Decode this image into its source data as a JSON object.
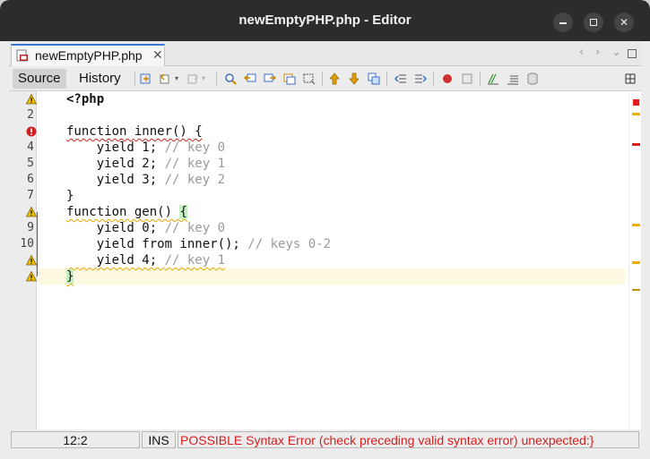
{
  "window": {
    "title": "newEmptyPHP.php - Editor",
    "controls": [
      "minimize",
      "maximize",
      "close"
    ]
  },
  "tabs": [
    {
      "label": "newEmptyPHP.php",
      "icon": "php-file-icon",
      "close": "✕"
    }
  ],
  "toolbar": {
    "source_label": "Source",
    "history_label": "History"
  },
  "editor": {
    "line_numbers": [
      "",
      "2",
      "",
      "4",
      "5",
      "6",
      "7",
      "",
      "9",
      "10",
      "",
      ""
    ],
    "gutter_icons": [
      {
        "line": 1,
        "icon": "warning-bulb-icon"
      },
      {
        "line": 3,
        "icon": "error-icon"
      },
      {
        "line": 8,
        "icon": "warning-icon"
      },
      {
        "line": 11,
        "icon": "warning-icon"
      },
      {
        "line": 12,
        "icon": "warning-icon"
      }
    ],
    "lines": [
      "<?php",
      "",
      "function inner() {",
      "    yield 1; // key 0",
      "    yield 2; // key 1",
      "    yield 3; // key 2",
      "}",
      "function gen() {",
      "    yield 0; // key 0",
      "    yield from inner(); // keys 0-2",
      "    yield 4; // key 1",
      "}"
    ],
    "code_parts": {
      "l3_kw": "function ",
      "l3_name": "inner() {",
      "l4_code": "    yield 1; ",
      "l4_cmt": "// key 0",
      "l5_code": "    yield 2; ",
      "l5_cmt": "// key 1",
      "l6_code": "    yield 3; ",
      "l6_cmt": "// key 2",
      "l7": "}",
      "l8_pre": "function gen() ",
      "l8_brace": "{",
      "l9_code": "    yield 0; ",
      "l9_cmt": "// key 0",
      "l10_code": "    yield from inner(); ",
      "l10_cmt": "// keys 0-2",
      "l11_pre": "    ",
      "l11_code": "yield 4; ",
      "l11_cmt": "// key 1",
      "l12": "}"
    },
    "current_line": 12,
    "colors": {
      "error": "#d0201a",
      "warning": "#e6a800",
      "current_line_bg": "#fcf9e0"
    }
  },
  "statusbar": {
    "position": "12:2",
    "mode": "INS",
    "message": "POSSIBLE Syntax Error (check preceding valid syntax error)  unexpected:}"
  }
}
